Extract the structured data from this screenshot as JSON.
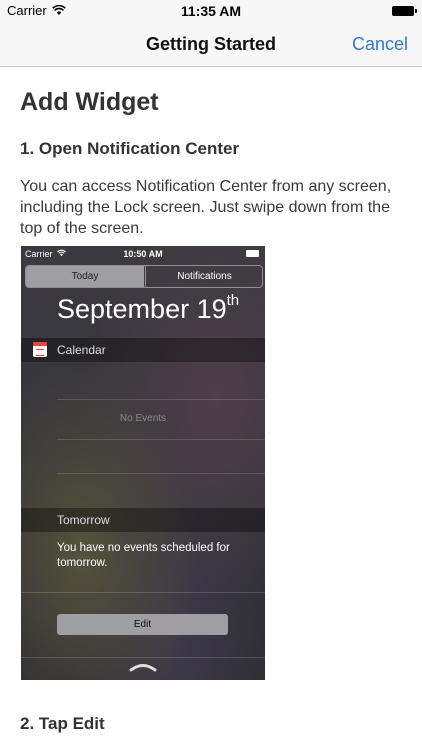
{
  "status_bar": {
    "carrier": "Carrier",
    "time": "11:35 AM"
  },
  "nav": {
    "title": "Getting Started",
    "cancel": "Cancel"
  },
  "content": {
    "heading": "Add Widget",
    "step1_title": "1. Open Notification Center",
    "step1_text": "You can access Notification Center from any screen, including the Lock screen. Just swipe down from the top of the screen.",
    "step2_title": "2. Tap Edit"
  },
  "screenshot": {
    "carrier": "Carrier",
    "time": "10:50 AM",
    "tabs": [
      "Today",
      "Notifications"
    ],
    "date_main": "September 19",
    "date_suffix": "th",
    "calendar_label": "Calendar",
    "no_events": "No Events",
    "tomorrow_label": "Tomorrow",
    "tomorrow_text": "You have no events scheduled for tomorrow.",
    "edit_label": "Edit"
  },
  "colors": {
    "accent": "#2f7ad6"
  }
}
